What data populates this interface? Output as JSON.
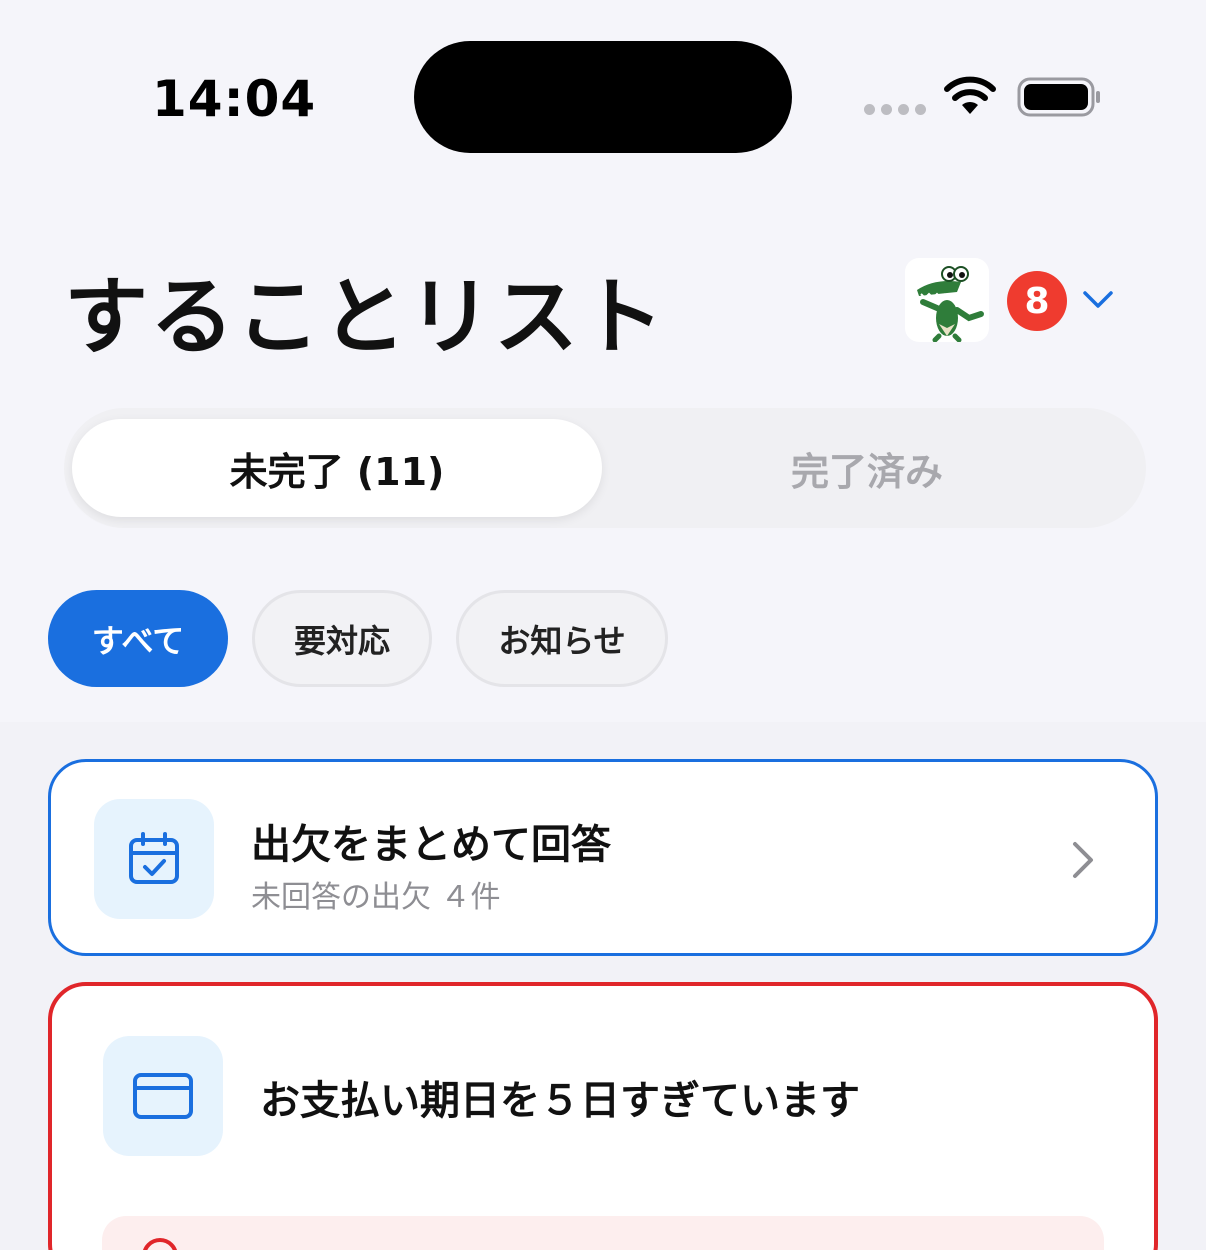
{
  "status_bar": {
    "time": "14:04"
  },
  "header": {
    "title": "することリスト",
    "notification_count": "8"
  },
  "segments": {
    "active": "未完了 (11)",
    "inactive": "完了済み"
  },
  "filters": [
    "すべて",
    "要対応",
    "お知らせ"
  ],
  "cards": {
    "attendance": {
      "title": "出欠をまとめて回答",
      "subtitle": "未回答の出欠 ４件",
      "icon": "calendar-check-icon"
    },
    "payment": {
      "title": "お支払い期日を５日すぎています",
      "icon": "credit-card-icon"
    }
  },
  "colors": {
    "accent": "#1a6fdf",
    "danger": "#e0262a",
    "badge": "#ef3b2f",
    "icon_tile": "#e6f3fd"
  }
}
